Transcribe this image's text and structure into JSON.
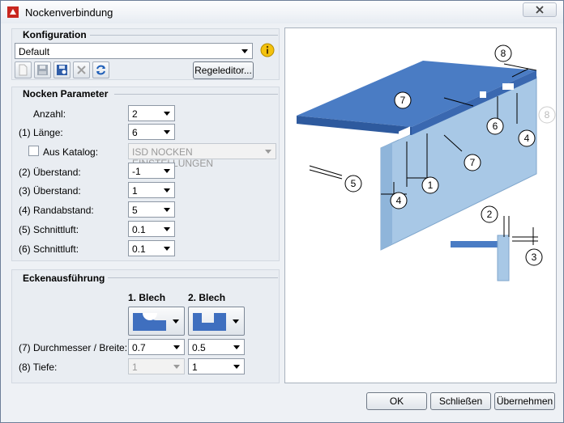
{
  "window": {
    "title": "Nockenverbindung"
  },
  "konfiguration": {
    "title": "Konfiguration",
    "selected": "Default",
    "regeleditor_label": "Regeleditor..."
  },
  "nocken": {
    "title": "Nocken Parameter",
    "anzahl_label": "Anzahl:",
    "anzahl_value": "2",
    "laenge_label": "(1) Länge:",
    "laenge_value": "6",
    "katalog_label": "Aus Katalog:",
    "katalog_value": "ISD NOCKEN EINSTELLUNGEN",
    "ueberstand2_label": "(2) Überstand:",
    "ueberstand2_value": "-1",
    "ueberstand3_label": "(3) Überstand:",
    "ueberstand3_value": "1",
    "randabstand_label": "(4) Randabstand:",
    "randabstand_value": "5",
    "schnittluft5_label": "(5) Schnittluft:",
    "schnittluft5_value": "0.1",
    "schnittluft6_label": "(6) Schnittluft:",
    "schnittluft6_value": "0.1"
  },
  "ecken": {
    "title": "Eckenausführung",
    "blech1_label": "1. Blech",
    "blech2_label": "2. Blech",
    "durchmesser_label": "(7) Durchmesser / Breite:",
    "durchmesser_value1": "0.7",
    "durchmesser_value2": "0.5",
    "tiefe_label": "(8) Tiefe:",
    "tiefe_value1": "1",
    "tiefe_value2": "1"
  },
  "preview": {
    "callouts": [
      "1",
      "2",
      "3",
      "4",
      "5",
      "6",
      "7",
      "8"
    ]
  },
  "buttons": {
    "ok": "OK",
    "close": "Schließen",
    "apply": "Übernehmen"
  },
  "colors": {
    "accent": "#4a7cc4",
    "sheet_side": "#a8c8e6",
    "sheet_top": "#3f6fbf"
  }
}
